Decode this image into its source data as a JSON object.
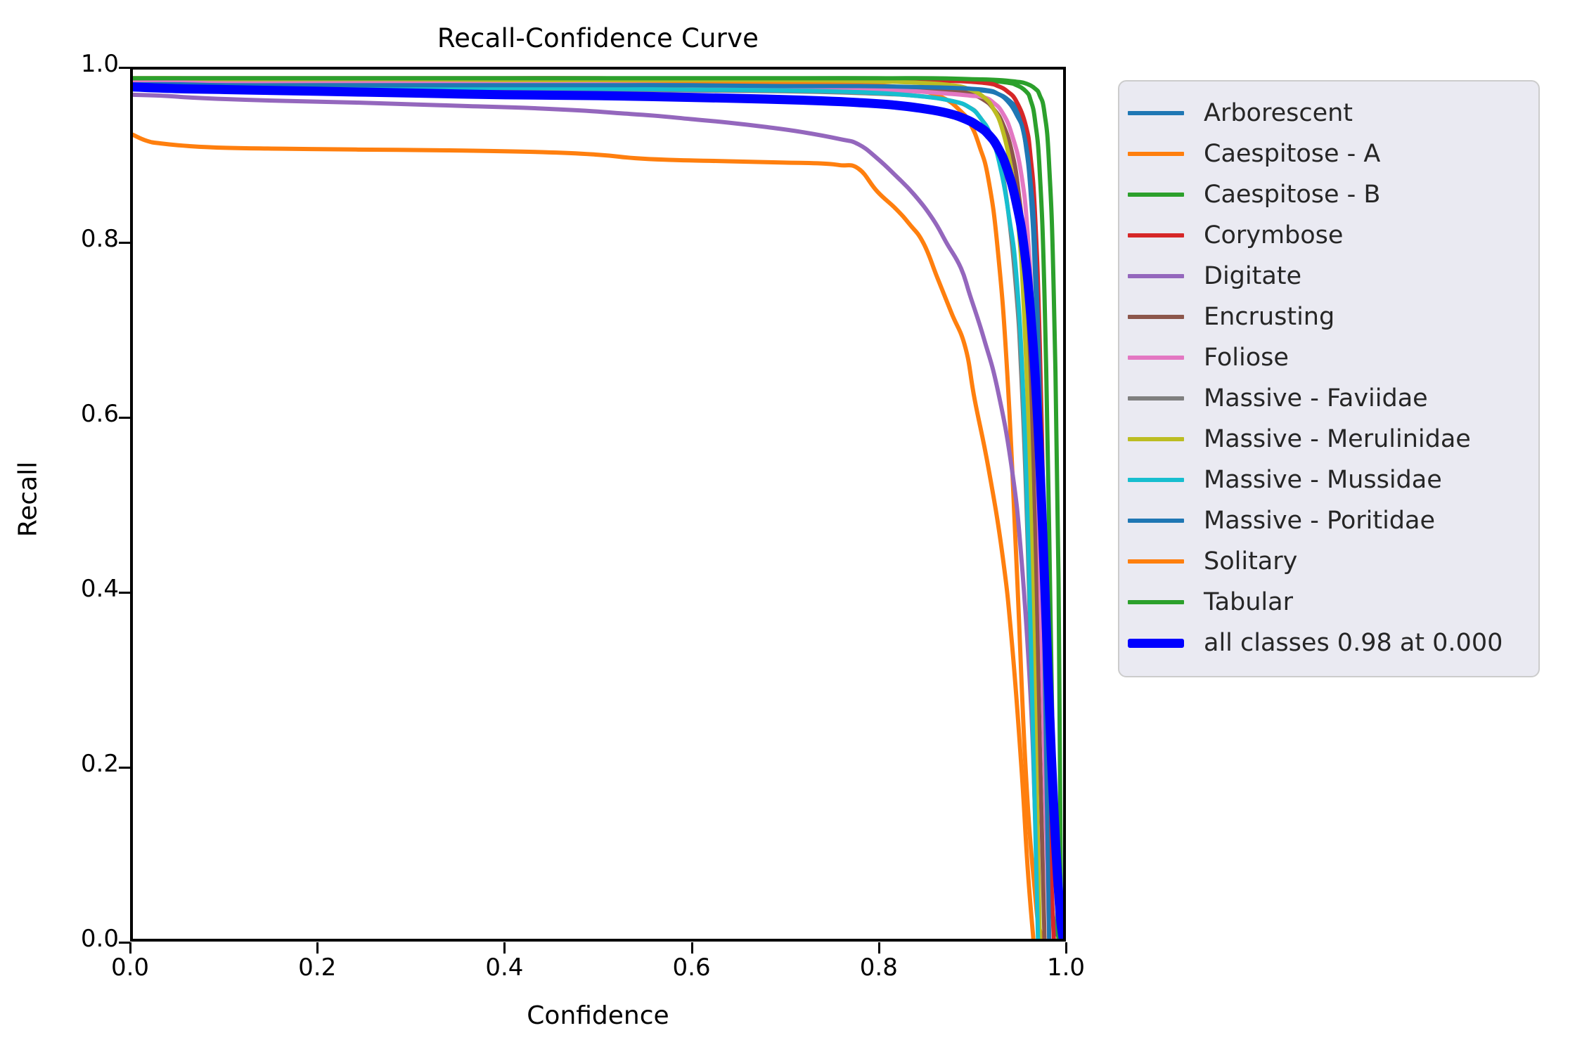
{
  "figure": {
    "title": "Recall-Confidence Curve",
    "xlabel": "Confidence",
    "ylabel": "Recall",
    "background": "#ffffff",
    "legend_background": "#eaeaf2",
    "legend_border": "#cccccc"
  },
  "axes": {
    "x_ticks": [
      "0.0",
      "0.2",
      "0.4",
      "0.6",
      "0.8",
      "1.0"
    ],
    "y_ticks": [
      "0.0",
      "0.2",
      "0.4",
      "0.6",
      "0.8",
      "1.0"
    ]
  },
  "legend": {
    "items": [
      {
        "label": "Arborescent",
        "color": "#1f77b4",
        "thick": false
      },
      {
        "label": "Caespitose - A",
        "color": "#ff7f0e",
        "thick": false
      },
      {
        "label": "Caespitose - B",
        "color": "#2ca02c",
        "thick": false
      },
      {
        "label": "Corymbose",
        "color": "#d62728",
        "thick": false
      },
      {
        "label": "Digitate",
        "color": "#9467bd",
        "thick": false
      },
      {
        "label": "Encrusting",
        "color": "#8c564b",
        "thick": false
      },
      {
        "label": "Foliose",
        "color": "#e377c2",
        "thick": false
      },
      {
        "label": "Massive - Faviidae",
        "color": "#7f7f7f",
        "thick": false
      },
      {
        "label": "Massive - Merulinidae",
        "color": "#bcbd22",
        "thick": false
      },
      {
        "label": "Massive - Mussidae",
        "color": "#17becf",
        "thick": false
      },
      {
        "label": "Massive - Poritidae",
        "color": "#1f77b4",
        "thick": false
      },
      {
        "label": "Solitary",
        "color": "#ff7f0e",
        "thick": false
      },
      {
        "label": "Tabular",
        "color": "#2ca02c",
        "thick": false
      },
      {
        "label": "all classes 0.98 at 0.000",
        "color": "#0000ff",
        "thick": true
      }
    ]
  },
  "chart_data": {
    "type": "line",
    "title": "Recall-Confidence Curve",
    "xlabel": "Confidence",
    "ylabel": "Recall",
    "xlim": [
      0.0,
      1.0
    ],
    "ylim": [
      0.0,
      1.0
    ],
    "grid": false,
    "legend_position": "right-outside",
    "annotations": [
      "all classes 0.98 at 0.000"
    ],
    "series": [
      {
        "name": "Arborescent",
        "color": "#1f77b4",
        "linewidth": 1.0,
        "x": [
          0.0,
          0.05,
          0.1,
          0.2,
          0.3,
          0.4,
          0.5,
          0.6,
          0.7,
          0.78,
          0.84,
          0.88,
          0.9,
          0.92,
          0.93,
          0.94,
          0.95,
          0.955,
          0.96,
          0.965,
          0.97,
          0.975,
          0.98,
          0.985,
          0.99,
          1.0
        ],
        "y": [
          0.984,
          0.984,
          0.983,
          0.983,
          0.982,
          0.982,
          0.981,
          0.981,
          0.98,
          0.98,
          0.979,
          0.978,
          0.977,
          0.975,
          0.972,
          0.966,
          0.955,
          0.94,
          0.912,
          0.86,
          0.76,
          0.58,
          0.33,
          0.11,
          0.02,
          0.0
        ]
      },
      {
        "name": "Caespitose - A",
        "color": "#ff7f0e",
        "linewidth": 1.0,
        "x": [
          0.0,
          0.05,
          0.1,
          0.2,
          0.3,
          0.4,
          0.5,
          0.55,
          0.6,
          0.66,
          0.7,
          0.75,
          0.8,
          0.84,
          0.87,
          0.89,
          0.9,
          0.91,
          0.92,
          0.93,
          0.94,
          0.95,
          0.96,
          0.97,
          0.975,
          0.98
        ],
        "y": [
          0.988,
          0.988,
          0.988,
          0.988,
          0.987,
          0.987,
          0.986,
          0.986,
          0.986,
          0.985,
          0.985,
          0.984,
          0.982,
          0.977,
          0.968,
          0.952,
          0.938,
          0.912,
          0.872,
          0.79,
          0.65,
          0.43,
          0.19,
          0.05,
          0.01,
          0.0
        ]
      },
      {
        "name": "Caespitose - B",
        "color": "#2ca02c",
        "linewidth": 1.0,
        "x": [
          0.0,
          0.05,
          0.1,
          0.2,
          0.3,
          0.4,
          0.5,
          0.6,
          0.7,
          0.8,
          0.86,
          0.9,
          0.92,
          0.94,
          0.95,
          0.96,
          0.965,
          0.97,
          0.975,
          0.98,
          0.985,
          0.99,
          0.995
        ],
        "y": [
          0.99,
          0.99,
          0.99,
          0.99,
          0.99,
          0.99,
          0.99,
          0.99,
          0.99,
          0.99,
          0.989,
          0.988,
          0.987,
          0.985,
          0.982,
          0.975,
          0.965,
          0.94,
          0.88,
          0.74,
          0.47,
          0.16,
          0.0
        ]
      },
      {
        "name": "Corymbose",
        "color": "#d62728",
        "linewidth": 1.0,
        "x": [
          0.0,
          0.05,
          0.1,
          0.2,
          0.3,
          0.4,
          0.5,
          0.6,
          0.7,
          0.78,
          0.84,
          0.88,
          0.9,
          0.92,
          0.93,
          0.94,
          0.95,
          0.96,
          0.965,
          0.97,
          0.975,
          0.98,
          0.985,
          0.99
        ],
        "y": [
          0.99,
          0.99,
          0.99,
          0.99,
          0.99,
          0.99,
          0.99,
          0.989,
          0.989,
          0.989,
          0.988,
          0.987,
          0.986,
          0.984,
          0.981,
          0.975,
          0.963,
          0.935,
          0.9,
          0.83,
          0.68,
          0.43,
          0.15,
          0.0
        ]
      },
      {
        "name": "Digitate",
        "color": "#9467bd",
        "linewidth": 1.0,
        "x": [
          0.0,
          0.03,
          0.06,
          0.1,
          0.16,
          0.24,
          0.3,
          0.36,
          0.42,
          0.48,
          0.52,
          0.56,
          0.6,
          0.64,
          0.68,
          0.72,
          0.76,
          0.78,
          0.8,
          0.82,
          0.84,
          0.86,
          0.875,
          0.89,
          0.9,
          0.915,
          0.93,
          0.945,
          0.955,
          0.965,
          0.97,
          0.975
        ],
        "y": [
          0.971,
          0.97,
          0.968,
          0.966,
          0.964,
          0.962,
          0.96,
          0.958,
          0.956,
          0.953,
          0.95,
          0.947,
          0.943,
          0.939,
          0.934,
          0.928,
          0.92,
          0.914,
          0.898,
          0.878,
          0.856,
          0.828,
          0.8,
          0.772,
          0.74,
          0.69,
          0.63,
          0.54,
          0.44,
          0.28,
          0.14,
          0.0
        ]
      },
      {
        "name": "Encrusting",
        "color": "#8c564b",
        "linewidth": 1.0,
        "x": [
          0.0,
          0.05,
          0.1,
          0.2,
          0.3,
          0.4,
          0.5,
          0.6,
          0.7,
          0.78,
          0.84,
          0.88,
          0.9,
          0.915,
          0.925,
          0.935,
          0.945,
          0.952,
          0.958,
          0.965,
          0.97,
          0.975,
          0.98
        ],
        "y": [
          0.984,
          0.984,
          0.983,
          0.983,
          0.982,
          0.982,
          0.981,
          0.981,
          0.98,
          0.979,
          0.978,
          0.976,
          0.972,
          0.965,
          0.955,
          0.938,
          0.905,
          0.86,
          0.79,
          0.64,
          0.47,
          0.22,
          0.0
        ]
      },
      {
        "name": "Foliose",
        "color": "#e377c2",
        "linewidth": 1.0,
        "x": [
          0.0,
          0.05,
          0.1,
          0.2,
          0.3,
          0.4,
          0.5,
          0.6,
          0.7,
          0.78,
          0.84,
          0.88,
          0.9,
          0.915,
          0.925,
          0.935,
          0.945,
          0.955,
          0.962,
          0.968,
          0.974,
          0.98,
          0.985
        ],
        "y": [
          0.986,
          0.986,
          0.985,
          0.985,
          0.984,
          0.984,
          0.983,
          0.982,
          0.98,
          0.978,
          0.975,
          0.972,
          0.97,
          0.968,
          0.962,
          0.95,
          0.925,
          0.88,
          0.81,
          0.69,
          0.48,
          0.2,
          0.0
        ]
      },
      {
        "name": "Massive - Faviidae",
        "color": "#7f7f7f",
        "linewidth": 1.0,
        "x": [
          0.0,
          0.05,
          0.1,
          0.2,
          0.3,
          0.4,
          0.5,
          0.6,
          0.7,
          0.78,
          0.84,
          0.88,
          0.9,
          0.91,
          0.92,
          0.93,
          0.94,
          0.95,
          0.955,
          0.96,
          0.965,
          0.97,
          0.975
        ],
        "y": [
          0.98,
          0.979,
          0.979,
          0.978,
          0.978,
          0.977,
          0.977,
          0.976,
          0.975,
          0.973,
          0.97,
          0.964,
          0.956,
          0.946,
          0.928,
          0.9,
          0.845,
          0.74,
          0.65,
          0.52,
          0.34,
          0.14,
          0.0
        ]
      },
      {
        "name": "Massive - Merulinidae",
        "color": "#bcbd22",
        "linewidth": 1.0,
        "x": [
          0.0,
          0.05,
          0.1,
          0.2,
          0.3,
          0.4,
          0.5,
          0.6,
          0.7,
          0.78,
          0.84,
          0.88,
          0.9,
          0.915,
          0.925,
          0.935,
          0.945,
          0.952,
          0.958,
          0.964,
          0.97,
          0.975
        ],
        "y": [
          0.99,
          0.99,
          0.989,
          0.989,
          0.989,
          0.988,
          0.988,
          0.988,
          0.988,
          0.987,
          0.985,
          0.982,
          0.977,
          0.968,
          0.955,
          0.93,
          0.88,
          0.82,
          0.72,
          0.54,
          0.26,
          0.0
        ]
      },
      {
        "name": "Massive - Mussidae",
        "color": "#17becf",
        "linewidth": 1.0,
        "x": [
          0.0,
          0.05,
          0.1,
          0.2,
          0.3,
          0.4,
          0.5,
          0.6,
          0.7,
          0.78,
          0.84,
          0.88,
          0.9,
          0.912,
          0.922,
          0.932,
          0.942,
          0.95,
          0.957,
          0.963,
          0.968,
          0.973
        ],
        "y": [
          0.981,
          0.981,
          0.98,
          0.98,
          0.979,
          0.979,
          0.978,
          0.977,
          0.976,
          0.974,
          0.97,
          0.964,
          0.956,
          0.943,
          0.925,
          0.89,
          0.83,
          0.76,
          0.63,
          0.44,
          0.22,
          0.0
        ]
      },
      {
        "name": "Massive - Poritidae",
        "color": "#1f77b4",
        "linewidth": 1.0,
        "x": [
          0.0,
          0.05,
          0.1,
          0.2,
          0.3,
          0.4,
          0.5,
          0.6,
          0.7,
          0.78,
          0.84,
          0.88,
          0.9,
          0.92,
          0.93,
          0.94,
          0.95,
          0.958,
          0.965,
          0.97,
          0.975,
          0.98,
          0.985
        ],
        "y": [
          0.983,
          0.983,
          0.982,
          0.982,
          0.982,
          0.982,
          0.982,
          0.982,
          0.981,
          0.981,
          0.98,
          0.979,
          0.978,
          0.976,
          0.972,
          0.964,
          0.948,
          0.925,
          0.87,
          0.79,
          0.62,
          0.33,
          0.0
        ]
      },
      {
        "name": "Solitary",
        "color": "#ff7f0e",
        "linewidth": 1.0,
        "x": [
          0.0,
          0.015,
          0.03,
          0.06,
          0.1,
          0.16,
          0.24,
          0.34,
          0.44,
          0.5,
          0.54,
          0.58,
          0.62,
          0.66,
          0.7,
          0.74,
          0.76,
          0.78,
          0.8,
          0.82,
          0.835,
          0.85,
          0.865,
          0.88,
          0.895,
          0.905,
          0.92,
          0.935,
          0.945,
          0.955,
          0.962,
          0.968
        ],
        "y": [
          0.925,
          0.918,
          0.915,
          0.912,
          0.91,
          0.909,
          0.908,
          0.907,
          0.905,
          0.902,
          0.898,
          0.896,
          0.895,
          0.894,
          0.893,
          0.892,
          0.89,
          0.886,
          0.86,
          0.84,
          0.822,
          0.8,
          0.76,
          0.72,
          0.68,
          0.62,
          0.54,
          0.44,
          0.34,
          0.2,
          0.08,
          0.0
        ]
      },
      {
        "name": "Tabular",
        "color": "#2ca02c",
        "linewidth": 1.0,
        "x": [
          0.0,
          0.05,
          0.1,
          0.2,
          0.3,
          0.4,
          0.5,
          0.6,
          0.7,
          0.8,
          0.86,
          0.9,
          0.93,
          0.95,
          0.96,
          0.97,
          0.975,
          0.98,
          0.985,
          0.99,
          0.995,
          0.998
        ],
        "y": [
          0.99,
          0.99,
          0.99,
          0.99,
          0.99,
          0.99,
          0.99,
          0.99,
          0.99,
          0.99,
          0.99,
          0.989,
          0.988,
          0.986,
          0.984,
          0.978,
          0.97,
          0.95,
          0.89,
          0.74,
          0.42,
          0.0
        ]
      },
      {
        "name": "all classes 0.98 at 0.000",
        "color": "#0000ff",
        "linewidth": 3.0,
        "x": [
          0.0,
          0.05,
          0.1,
          0.2,
          0.3,
          0.4,
          0.5,
          0.6,
          0.68,
          0.74,
          0.78,
          0.82,
          0.85,
          0.875,
          0.895,
          0.91,
          0.92,
          0.93,
          0.94,
          0.95,
          0.958,
          0.965,
          0.972,
          0.978,
          0.984,
          0.99,
          0.996,
          1.0
        ],
        "y": [
          0.98,
          0.978,
          0.977,
          0.975,
          0.973,
          0.971,
          0.97,
          0.968,
          0.966,
          0.964,
          0.962,
          0.959,
          0.955,
          0.95,
          0.943,
          0.934,
          0.925,
          0.91,
          0.885,
          0.845,
          0.795,
          0.72,
          0.61,
          0.47,
          0.3,
          0.15,
          0.04,
          0.0
        ]
      }
    ]
  }
}
